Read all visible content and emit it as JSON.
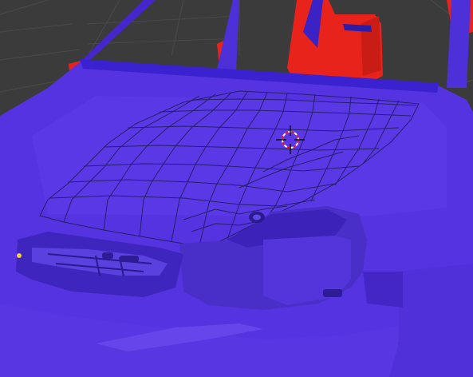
{
  "viewport": {
    "name": "3d-viewport",
    "background_color": "#3b3b3b",
    "grid_color": "#4a4a4a"
  },
  "model": {
    "front_face_color": "#5533e0",
    "back_face_color": "#e8231c",
    "wireframe_color": "#1c1c55"
  },
  "axis": {
    "x_axis_color": "#8a3f3f",
    "y_axis_color": "#6b8e2a"
  },
  "cursor": {
    "name": "3d-cursor",
    "ring_colors": [
      "#ffffff",
      "#e0102a"
    ]
  }
}
